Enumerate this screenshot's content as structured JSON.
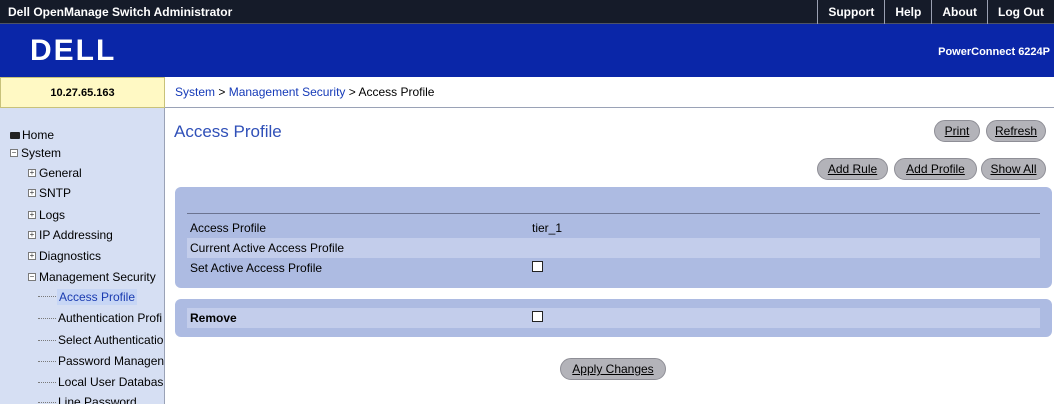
{
  "app": {
    "title": "Dell OpenManage Switch Administrator",
    "nav": [
      "Support",
      "Help",
      "About",
      "Log Out"
    ],
    "logo": "DELL",
    "model": "PowerConnect 6224P",
    "ip": "10.27.65.163"
  },
  "breadcrumb": {
    "part1": "System",
    "sep1": " > ",
    "part2": "Management Security",
    "sep2": " > ",
    "current": "Access Profile"
  },
  "sidebar": {
    "home": "Home",
    "system": "System",
    "general": "General",
    "sntp": "SNTP",
    "logs": "Logs",
    "ip_addressing": "IP Addressing",
    "diagnostics": "Diagnostics",
    "mgmt_security": "Management Security",
    "access_profile": "Access Profile",
    "auth_profile": "Authentication Profi",
    "select_auth": "Select Authenticatio",
    "password_mgmt": "Password Managen",
    "local_user_db": "Local User Databas",
    "line_password": "Line Password"
  },
  "page": {
    "title": "Access Profile",
    "buttons": {
      "print": "Print",
      "refresh": "Refresh",
      "add_rule": "Add Rule",
      "add_profile": "Add Profile",
      "show_all": "Show All",
      "apply": "Apply Changes"
    },
    "form": {
      "access_profile_label": "Access Profile",
      "access_profile_value": "tier_1",
      "current_active_label": "Current Active Access Profile",
      "current_active_value": "",
      "set_active_label": "Set Active Access Profile",
      "set_active_checked": false,
      "remove_label": "Remove",
      "remove_checked": false
    }
  },
  "colors": {
    "banner": "#0a26a8",
    "topbar": "#151b29",
    "panel": "#adbbe2",
    "sidebar": "#d6dff3",
    "title": "#3050b8"
  }
}
